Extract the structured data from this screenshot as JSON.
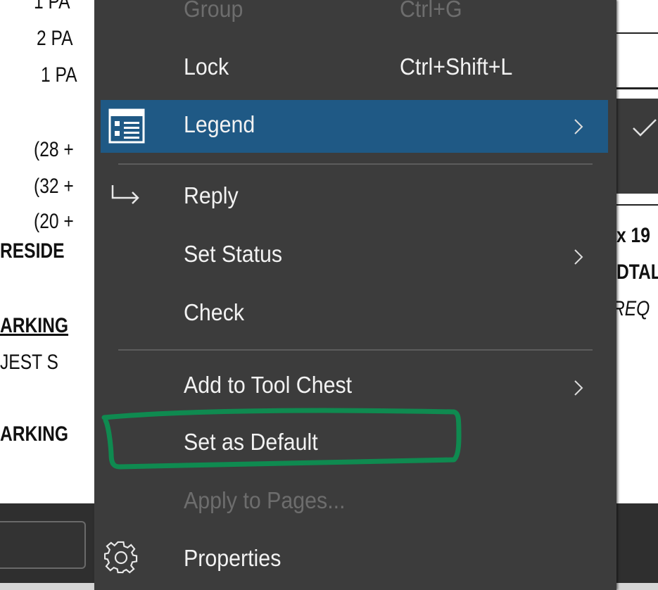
{
  "document": {
    "lines": [
      "1 PA",
      "2 PA",
      "1 PA",
      "(28 +",
      "(32 +",
      "(20 +",
      "RESIDE",
      "ARKING",
      "JEST S",
      "ARKING"
    ],
    "right_lines": [
      "x 19",
      "DTAL",
      "REQ"
    ]
  },
  "menu": {
    "items": [
      {
        "label": "Group",
        "shortcut": "Ctrl+G",
        "disabled": true
      },
      {
        "label": "Lock",
        "shortcut": "Ctrl+Shift+L"
      },
      {
        "label": "Legend",
        "icon": "legend-icon",
        "submenu": true,
        "highlighted": true
      },
      {
        "label": "Reply",
        "icon": "reply-arrow-icon"
      },
      {
        "label": "Set Status",
        "submenu": true
      },
      {
        "label": "Check"
      },
      {
        "label": "Add to Tool Chest",
        "submenu": true
      },
      {
        "label": "Set as Default"
      },
      {
        "label": "Apply to Pages...",
        "disabled": true
      },
      {
        "label": "Properties",
        "icon": "gear-icon"
      }
    ]
  },
  "colors": {
    "menu_bg": "#3c3c3c",
    "highlight": "#1f5985",
    "annotation": "#0f8a50",
    "text": "#f2f2f2",
    "disabled_text": "#6d6d6d"
  }
}
